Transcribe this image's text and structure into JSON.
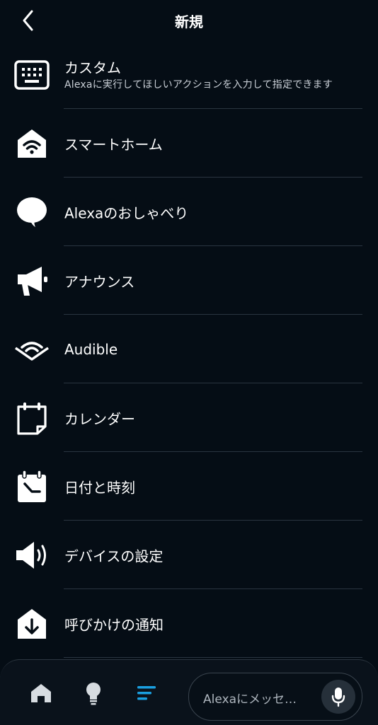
{
  "header": {
    "title": "新規"
  },
  "items": [
    {
      "label": "カスタム",
      "sub": "Alexaに実行してほしいアクションを入力して指定できます",
      "icon": "keyboard-icon"
    },
    {
      "label": "スマートホーム",
      "icon": "smart-home-icon"
    },
    {
      "label": "Alexaのおしゃべり",
      "icon": "speech-bubble-icon"
    },
    {
      "label": "アナウンス",
      "icon": "megaphone-icon"
    },
    {
      "label": "Audible",
      "icon": "audible-icon"
    },
    {
      "label": "カレンダー",
      "icon": "calendar-icon"
    },
    {
      "label": "日付と時刻",
      "icon": "date-time-icon"
    },
    {
      "label": "デバイスの設定",
      "icon": "speaker-volume-icon"
    },
    {
      "label": "呼びかけの通知",
      "icon": "notification-download-icon"
    }
  ],
  "nav": {
    "message_placeholder": "Alexaにメッセ…",
    "active_color": "#1a9fe0"
  }
}
